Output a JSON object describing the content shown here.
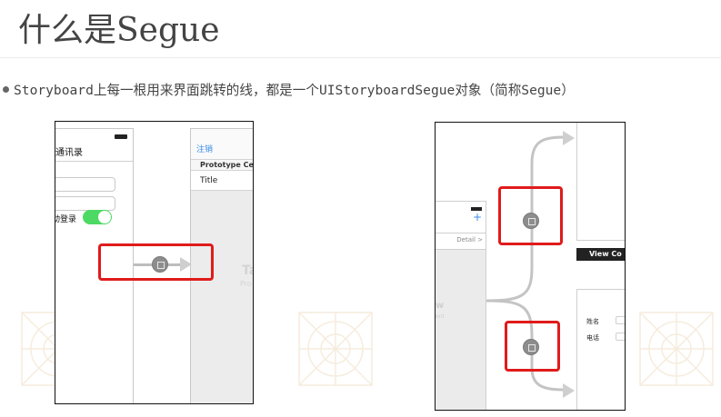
{
  "slide": {
    "title": "什么是Segue",
    "bullet": "Storyboard上每一根用来界面跳转的线，都是一个UIStoryboardSegue对象（简称Segue）"
  },
  "screenshot_1": {
    "nav_title": "通讯录",
    "switch_label": "动登录",
    "switch_on": true,
    "table_nav_button": "注销",
    "prototype_cells_header": "Prototype Cell",
    "cell_title": "Title",
    "ghost_text": "Ta",
    "ghost_subtext": "Pro"
  },
  "screenshot_2": {
    "nav_plus": "+",
    "detail_label": "Detail >",
    "ghost_text": "w",
    "ghost_subtext": "ent",
    "view_controller_bar": "View Co",
    "field_1_label": "姓名",
    "field_2_label": "电话"
  },
  "colors": {
    "highlight_border": "#e01b1b",
    "switch_on": "#4cd964",
    "ios_blue": "#3a8be8"
  }
}
